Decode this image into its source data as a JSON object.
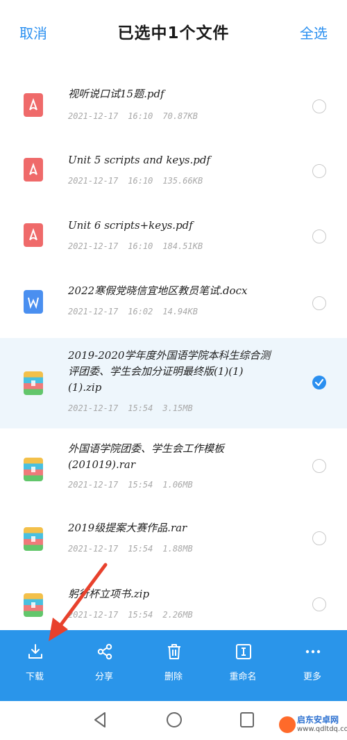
{
  "header": {
    "cancel_label": "取消",
    "title": "已选中1个文件",
    "select_all_label": "全选"
  },
  "files": [
    {
      "name": "视听说口试15题.pdf",
      "date": "2021-12-17",
      "time": "16:10",
      "size": "70.87KB",
      "type": "pdf",
      "selected": false
    },
    {
      "name": "Unit 5 scripts and keys.pdf",
      "date": "2021-12-17",
      "time": "16:10",
      "size": "135.66KB",
      "type": "pdf",
      "selected": false
    },
    {
      "name": "Unit 6 scripts+keys.pdf",
      "date": "2021-12-17",
      "time": "16:10",
      "size": "184.51KB",
      "type": "pdf",
      "selected": false
    },
    {
      "name": "2022寒假党晓信宜地区教员笔试.docx",
      "date": "2021-12-17",
      "time": "16:02",
      "size": "14.94KB",
      "type": "doc",
      "selected": false
    },
    {
      "name": "2019-2020学年度外国语学院本科生综合测评团委、学生会加分证明最终版(1)(1)(1).zip",
      "date": "2021-12-17",
      "time": "15:54",
      "size": "3.15MB",
      "type": "zip",
      "selected": true
    },
    {
      "name": "外国语学院团委、学生会工作模板(201019).rar",
      "date": "2021-12-17",
      "time": "15:54",
      "size": "1.06MB",
      "type": "zip",
      "selected": false
    },
    {
      "name": "2019级提案大赛作品.rar",
      "date": "2021-12-17",
      "time": "15:54",
      "size": "1.88MB",
      "type": "zip",
      "selected": false
    },
    {
      "name": "躬行杯立项书.zip",
      "date": "2021-12-17",
      "time": "15:54",
      "size": "2.26MB",
      "type": "zip",
      "selected": false
    }
  ],
  "toolbar": [
    {
      "label": "下载",
      "icon": "download-icon"
    },
    {
      "label": "分享",
      "icon": "share-icon"
    },
    {
      "label": "删除",
      "icon": "trash-icon"
    },
    {
      "label": "重命名",
      "icon": "rename-icon"
    },
    {
      "label": "更多",
      "icon": "more-icon"
    }
  ],
  "watermark": {
    "name": "启东安卓网",
    "url": "www.qdltdq.com"
  },
  "colors": {
    "accent": "#2a8ff0",
    "toolbar": "#2a95ea",
    "pdf": "#ef6a6a",
    "doc": "#4a8ff0",
    "annotation_arrow": "#e8412c"
  }
}
